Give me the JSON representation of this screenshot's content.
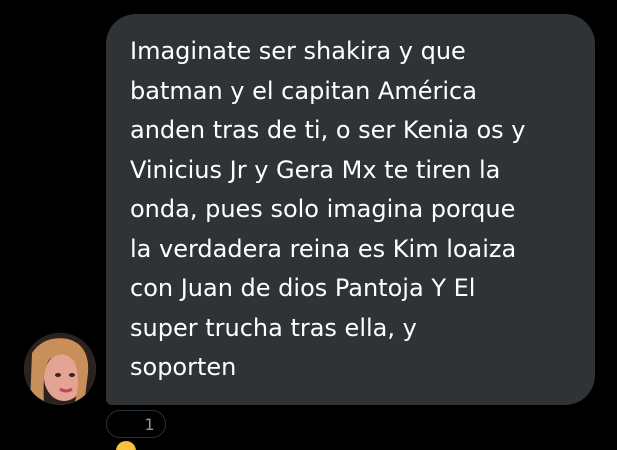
{
  "message": {
    "text": "Imaginate ser shakira y que\nbatman y el capitan América\nanden tras de ti, o ser Kenia os y\nVinicius Jr y Gera Mx te tiren la\nonda, pues solo imagina porque\nla verdadera reina es Kim loaiza\ncon Juan de dios Pantoja Y El\nsuper trucha tras ella, y\nsoporten"
  },
  "reaction": {
    "emoji": "😂",
    "count": "1"
  },
  "avatar": {
    "icon": "user-avatar"
  },
  "colors": {
    "background": "#000000",
    "bubble": "#2f3336",
    "text": "#ffffff",
    "muted": "#8b98a5"
  }
}
